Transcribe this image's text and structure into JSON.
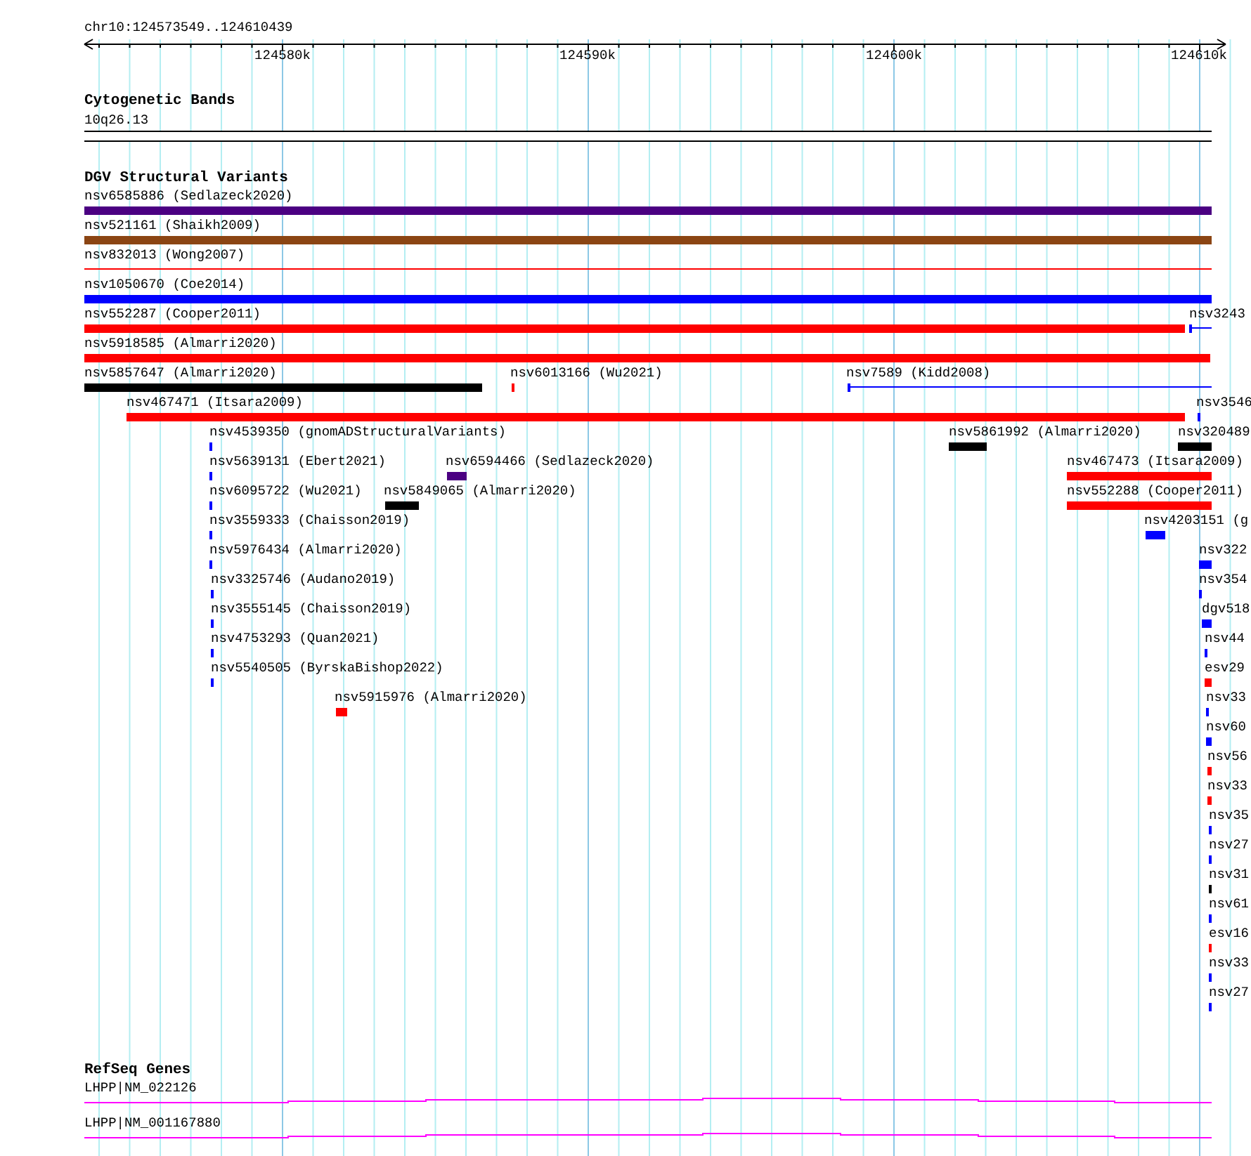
{
  "ruler": {
    "location": "chr10:124573549..124610439",
    "ticks": [
      "124580k",
      "124590k",
      "124600k",
      "124610k"
    ]
  },
  "tracks": [
    {
      "kind": "bands",
      "title": "Cytogenetic Bands",
      "features": [
        {
          "label": "10q26.13"
        }
      ]
    },
    {
      "kind": "variants",
      "title": "DGV Structural Variants",
      "rows": [
        [
          {
            "label": "nsv6585886 (Sedlazeck2020)",
            "color": "#4b0082",
            "kind": "bar"
          }
        ],
        [
          {
            "label": "nsv521161 (Shaikh2009)",
            "color": "#8b4513",
            "kind": "bar"
          }
        ],
        [
          {
            "label": "nsv832013 (Wong2007)",
            "color": "#ff0000",
            "kind": "line"
          }
        ],
        [
          {
            "label": "nsv1050670 (Coe2014)",
            "color": "#0000ff",
            "kind": "bar"
          }
        ],
        [
          {
            "label": "nsv552287 (Cooper2011)",
            "color": "#ff0000",
            "kind": "bar"
          },
          {
            "label": "nsv3243",
            "color": "#0000ff",
            "kind": "stub"
          }
        ],
        [
          {
            "label": "nsv5918585 (Almarri2020)",
            "color": "#ff0000",
            "kind": "bar"
          }
        ],
        [
          {
            "label": "nsv5857647 (Almarri2020)",
            "color": "#000000",
            "kind": "bar"
          },
          {
            "label": "nsv6013166 (Wu2021)",
            "color": "#ff0000",
            "kind": "bar"
          },
          {
            "label": "nsv7589 (Kidd2008)",
            "color": "#0000ff",
            "kind": "stub"
          }
        ],
        [
          {
            "label": "nsv467471 (Itsara2009)",
            "color": "#ff0000",
            "kind": "bar"
          },
          {
            "label": "nsv3546",
            "color": "#0000ff",
            "kind": "bar"
          }
        ],
        [
          {
            "label": "nsv4539350 (gnomADStructuralVariants)",
            "color": "#0000ff",
            "kind": "bar"
          },
          {
            "label": "nsv5861992 (Almarri2020)",
            "color": "#000000",
            "kind": "bar"
          },
          {
            "label": "nsv320489",
            "color": "#000000",
            "kind": "bar"
          }
        ],
        [
          {
            "label": "nsv5639131 (Ebert2021)",
            "color": "#0000ff",
            "kind": "bar"
          },
          {
            "label": "nsv6594466 (Sedlazeck2020)",
            "color": "#4b0082",
            "kind": "bar"
          },
          {
            "label": "nsv467473 (Itsara2009)",
            "color": "#ff0000",
            "kind": "bar"
          }
        ],
        [
          {
            "label": "nsv6095722 (Wu2021)",
            "color": "#0000ff",
            "kind": "bar"
          },
          {
            "label": "nsv5849065 (Almarri2020)",
            "color": "#000000",
            "kind": "bar"
          },
          {
            "label": "nsv552288 (Cooper2011)",
            "color": "#ff0000",
            "kind": "bar"
          }
        ],
        [
          {
            "label": "nsv3559333 (Chaisson2019)",
            "color": "#0000ff",
            "kind": "bar"
          },
          {
            "label": "nsv4203151 (g",
            "color": "#0000ff",
            "kind": "bar"
          }
        ],
        [
          {
            "label": "nsv5976434 (Almarri2020)",
            "color": "#0000ff",
            "kind": "bar"
          },
          {
            "label": "nsv322",
            "color": "#0000ff",
            "kind": "bar"
          }
        ],
        [
          {
            "label": "nsv3325746 (Audano2019)",
            "color": "#0000ff",
            "kind": "bar"
          },
          {
            "label": "nsv354",
            "color": "#0000ff",
            "kind": "bar"
          }
        ],
        [
          {
            "label": "nsv3555145 (Chaisson2019)",
            "color": "#0000ff",
            "kind": "bar"
          },
          {
            "label": "dgv518",
            "color": "#0000ff",
            "kind": "bar"
          }
        ],
        [
          {
            "label": "nsv4753293 (Quan2021)",
            "color": "#0000ff",
            "kind": "bar"
          },
          {
            "label": "nsv44",
            "color": "#0000ff",
            "kind": "bar"
          }
        ],
        [
          {
            "label": "nsv5540505 (ByrskaBishop2022)",
            "color": "#0000ff",
            "kind": "bar"
          },
          {
            "label": "esv29",
            "color": "#ff0000",
            "kind": "bar"
          }
        ],
        [
          {
            "label": "nsv5915976 (Almarri2020)",
            "color": "#ff0000",
            "kind": "bar"
          },
          {
            "label": "nsv33",
            "color": "#0000ff",
            "kind": "bar"
          }
        ],
        [
          {
            "label": "nsv60",
            "color": "#0000ff",
            "kind": "bar"
          }
        ],
        [
          {
            "label": "nsv56",
            "color": "#ff0000",
            "kind": "bar"
          }
        ],
        [
          {
            "label": "nsv33",
            "color": "#ff0000",
            "kind": "bar"
          }
        ],
        [
          {
            "label": "nsv35",
            "color": "#0000ff",
            "kind": "bar"
          }
        ],
        [
          {
            "label": "nsv27",
            "color": "#0000ff",
            "kind": "bar"
          }
        ],
        [
          {
            "label": "nsv31",
            "color": "#000000",
            "kind": "bar"
          }
        ],
        [
          {
            "label": "nsv61",
            "color": "#0000ff",
            "kind": "bar"
          }
        ],
        [
          {
            "label": "esv16",
            "color": "#ff0000",
            "kind": "bar"
          }
        ],
        [
          {
            "label": "nsv33",
            "color": "#0000ff",
            "kind": "bar"
          }
        ],
        [
          {
            "label": "nsv27",
            "color": "#0000ff",
            "kind": "bar"
          }
        ]
      ]
    },
    {
      "kind": "genes",
      "title": "RefSeq Genes",
      "features": [
        {
          "label": "LHPP|NM_022126"
        },
        {
          "label": "LHPP|NM_001167880"
        }
      ]
    }
  ]
}
